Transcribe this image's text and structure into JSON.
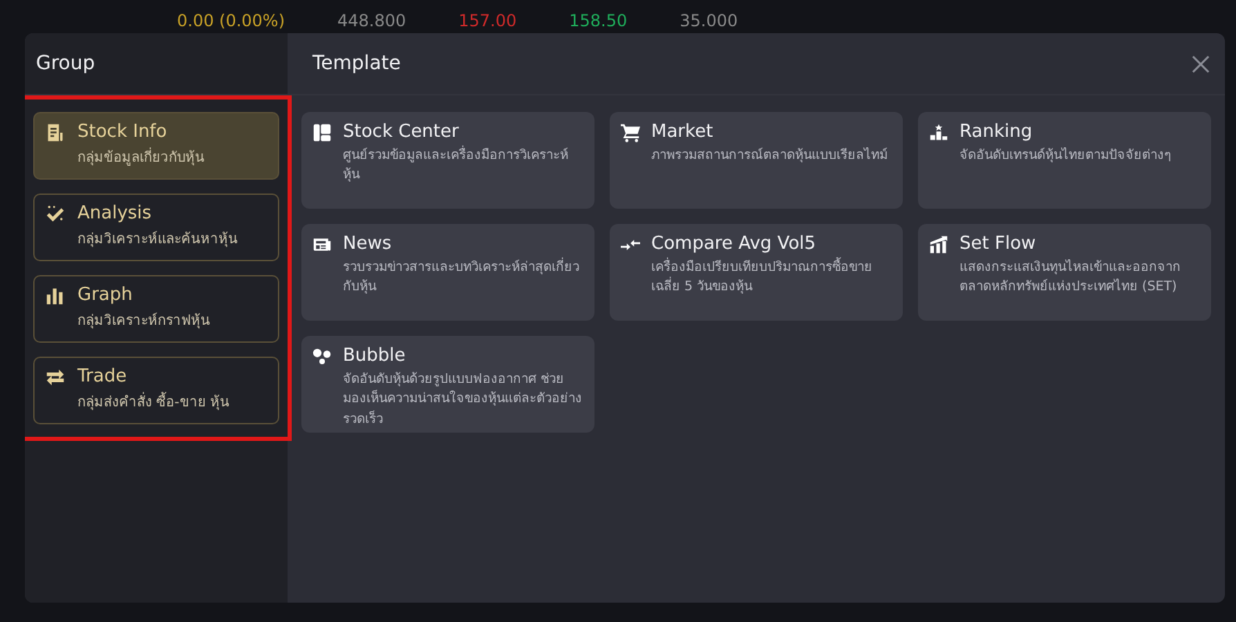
{
  "background": {
    "ticker": [
      {
        "text": "0.00 (0.00%)",
        "color": "#c9a227"
      },
      {
        "text": "448.800",
        "color": "#8a8a8a"
      },
      {
        "text": "157.00",
        "color": "#d12a2a"
      },
      {
        "text": "158.50",
        "color": "#1fae5b"
      },
      {
        "text": "35.000",
        "color": "#8a8a8a"
      }
    ]
  },
  "dialog": {
    "group_title": "Group",
    "template_title": "Template",
    "groups": [
      {
        "kind": "document",
        "label": "Stock Info",
        "description": "กลุ่มข้อมูลเกี่ยวกับหุ้น",
        "selected": true
      },
      {
        "kind": "wand",
        "label": "Analysis",
        "description": "กลุ่มวิเคราะห์และค้นหาหุ้น",
        "selected": false
      },
      {
        "kind": "bars",
        "label": "Graph",
        "description": "กลุ่มวิเคราะห์กราฟหุ้น",
        "selected": false
      },
      {
        "kind": "arrows",
        "label": "Trade",
        "description": "กลุ่มส่งคำสั่ง ซื้อ-ขาย หุ้น",
        "selected": false
      }
    ],
    "templates": [
      {
        "kind": "layout",
        "label": "Stock Center",
        "description": "ศูนย์รวมข้อมูลและเครื่องมือการวิเคราะห์หุ้น"
      },
      {
        "kind": "cart",
        "label": "Market",
        "description": "ภาพรวมสถานการณ์ตลาดหุ้นแบบเรียลไทม์"
      },
      {
        "kind": "podium",
        "label": "Ranking",
        "description": "จัดอันดับเทรนด์หุ้นไทยตามปัจจัยต่างๆ"
      },
      {
        "kind": "newspaper",
        "label": "News",
        "description": "รวบรวมข่าวสารและบทวิเคราะห์ล่าสุดเกี่ยวกับหุ้น"
      },
      {
        "kind": "compare",
        "label": "Compare Avg Vol5",
        "description": "เครื่องมือเปรียบเทียบปริมาณการซื้อขายเฉลี่ย 5 วันของหุ้น"
      },
      {
        "kind": "flow",
        "label": "Set Flow",
        "description": "แสดงกระแสเงินทุนไหลเข้าและออกจากตลาดหลักทรัพย์แห่งประเทศไทย (SET)"
      },
      {
        "kind": "bubbles",
        "label": "Bubble",
        "description": "จัดอันดับหุ้นด้วยรูปแบบฟองอากาศ ช่วยมองเห็นความน่าสนใจของหุ้นแต่ละตัวอย่างรวดเร็ว"
      }
    ]
  }
}
